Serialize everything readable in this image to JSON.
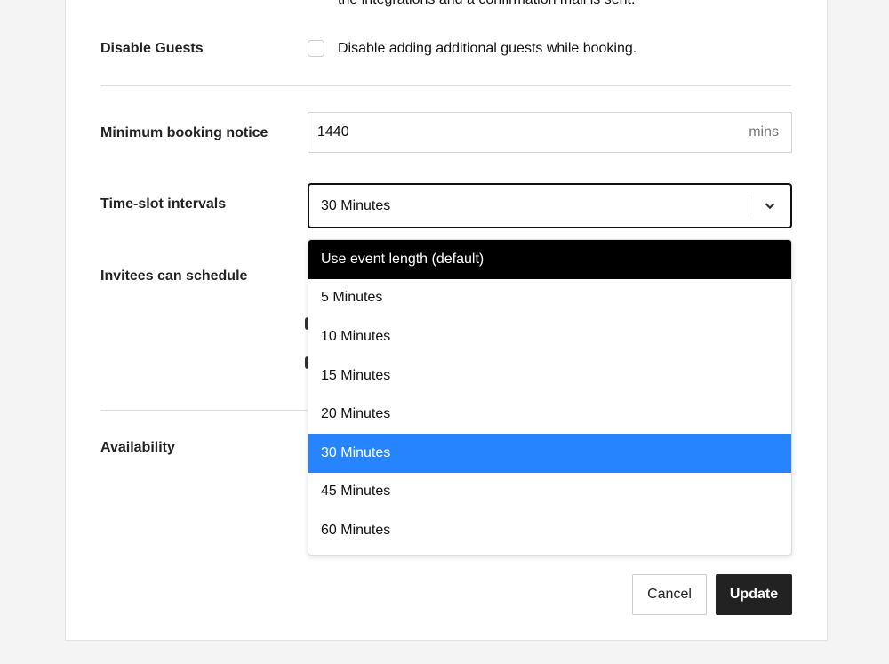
{
  "confirmation_note_tail": "the integrations and a confirmation mail is sent.",
  "disable_guests": {
    "label": "Disable Guests",
    "checkbox_text": "Disable adding additional guests while booking.",
    "checked": false
  },
  "minimum_notice": {
    "label": "Minimum booking notice",
    "value": "1440",
    "unit": "mins"
  },
  "time_slot": {
    "label": "Time-slot intervals",
    "selected": "30 Minutes",
    "options": [
      "Use event length (default)",
      "5 Minutes",
      "10 Minutes",
      "15 Minutes",
      "20 Minutes",
      "30 Minutes",
      "45 Minutes",
      "60 Minutes"
    ]
  },
  "invitees_label": "Invitees can schedule",
  "availability_label": "Availability",
  "buttons": {
    "cancel": "Cancel",
    "update": "Update"
  },
  "colors": {
    "selected_option": "#2684ff",
    "focused_option": "#000000",
    "primary_button": "#222222"
  }
}
